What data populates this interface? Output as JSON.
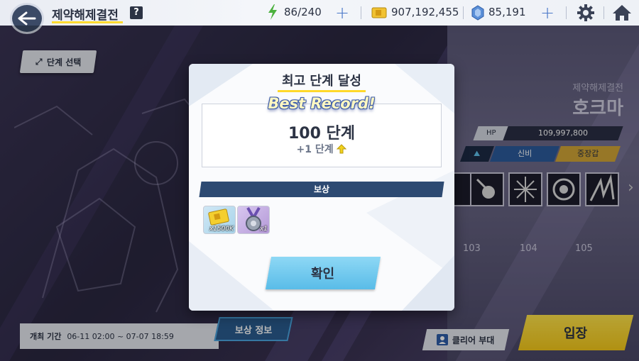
{
  "header": {
    "title": "제약해제결전",
    "help_label": "?",
    "stamina": "86/240",
    "gold": "907,192,455",
    "crystals": "85,191"
  },
  "left": {
    "stage_select_label": "단계 선택",
    "period_label": "개최 기간",
    "period_value": "06-11 02:00 ~ 07-07 18:59",
    "reward_info_label": "보상 정보"
  },
  "boss": {
    "subtitle": "제약해제결전",
    "name": "호크마",
    "hp_label": "HP",
    "hp_value": "109,997,800",
    "tags": [
      "신비",
      "중장갑"
    ],
    "levels": [
      "103",
      "104",
      "105"
    ]
  },
  "bottom_right": {
    "clear_team_label": "클리어 부대",
    "enter_label": "입장"
  },
  "modal": {
    "title": "최고 단계 달성",
    "best_record": "Best Record!",
    "stage_value": "100 단계",
    "stage_delta": "+1 단계",
    "reward_header": "보상",
    "rewards": [
      {
        "icon": "credit-ticket-icon",
        "qty": "x1500K"
      },
      {
        "icon": "medal-icon",
        "qty": "x1"
      }
    ],
    "confirm_label": "확인"
  }
}
